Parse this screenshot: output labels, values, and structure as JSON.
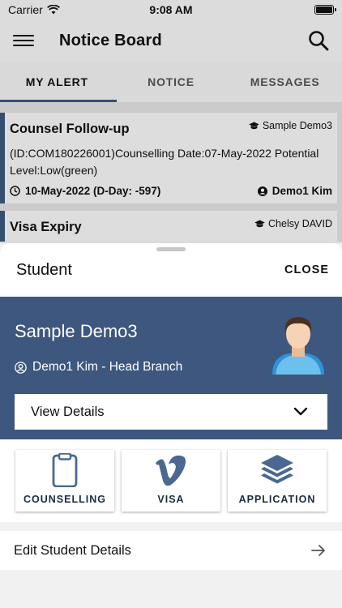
{
  "status_bar": {
    "carrier": "Carrier",
    "time": "9:08 AM"
  },
  "nav": {
    "title": "Notice Board",
    "menu_icon": "hamburger-icon",
    "search_icon": "search-icon"
  },
  "tabs": [
    {
      "label": "MY ALERT",
      "active": true
    },
    {
      "label": "NOTICE",
      "active": false
    },
    {
      "label": "MESSAGES",
      "active": false
    }
  ],
  "alerts": [
    {
      "title": "Counsel Follow-up",
      "student": "Sample Demo3",
      "description": "(ID:COM180226001)Counselling Date:07-May-2022 Potential Level:Low(green)",
      "date": "10-May-2022 (D-Day: -597)",
      "staff": "Demo1 Kim"
    },
    {
      "title": "Visa Expiry",
      "student": "Chelsy DAVID"
    }
  ],
  "sheet": {
    "title": "Student",
    "close_label": "CLOSE",
    "student_name": "Sample Demo3",
    "branch": "Demo1 Kim - Head Branch",
    "view_details_label": "View Details",
    "actions": [
      {
        "label": "COUNSELLING",
        "icon": "clipboard-icon"
      },
      {
        "label": "VISA",
        "icon": "vimeo-v-icon"
      },
      {
        "label": "APPLICATION",
        "icon": "layers-icon"
      }
    ],
    "edit_label": "Edit Student Details"
  },
  "colors": {
    "accent": "#3d577f",
    "sheet_bg": "#f1f1f1"
  }
}
